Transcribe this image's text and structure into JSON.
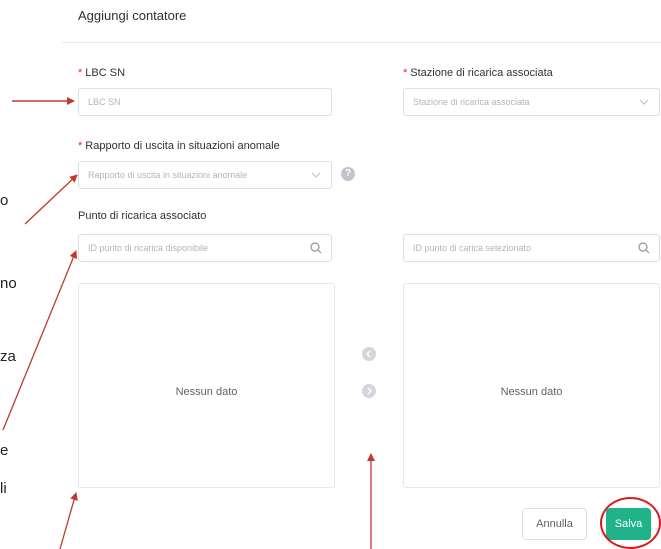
{
  "modal": {
    "title": "Aggiungi contatore"
  },
  "form": {
    "lbc_sn": {
      "label": "LBC SN",
      "placeholder": "LBC SN"
    },
    "station": {
      "label": "Stazione di ricarica associata",
      "placeholder": "Stazione di ricarica associata"
    },
    "report": {
      "label": "Rapporto di uscita in situazioni anomale",
      "placeholder": "Rapporto di uscita in situazioni anomale",
      "help": "?"
    },
    "charging_point": {
      "label": "Punto di ricarica associato"
    }
  },
  "transfer": {
    "left_search_placeholder": "ID punto di ricarica disponibile",
    "right_search_placeholder": "ID punto di carica selezionato",
    "left_empty": "Nessun dato",
    "right_empty": "Nessun dato"
  },
  "footer": {
    "cancel_label": "Annulla",
    "save_label": "Salva"
  },
  "side_text_fragments": [
    "o",
    "no",
    "za",
    "e",
    "li"
  ],
  "colors": {
    "primary": "#20b389",
    "required": "#f5222d",
    "annotation": "#c0392b",
    "highlight_circle": "#d81c1c"
  }
}
